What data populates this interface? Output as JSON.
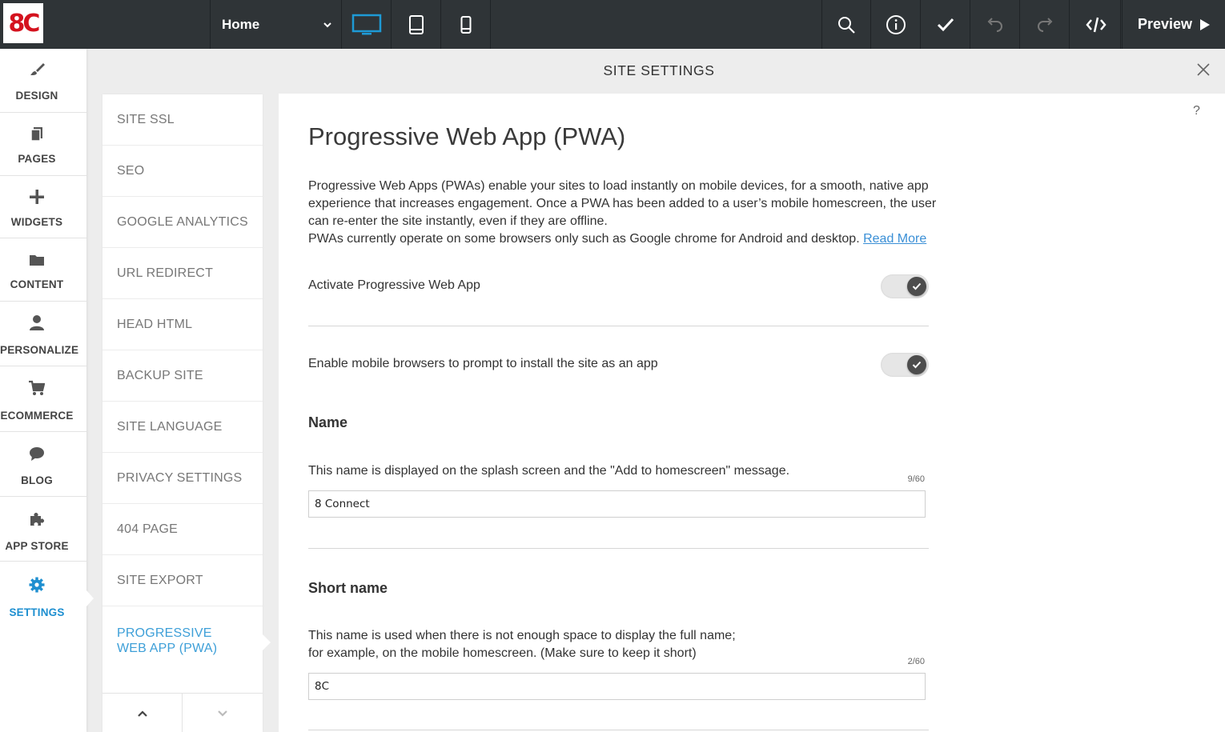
{
  "topbar": {
    "logo_text": "8C",
    "page_select": "Home",
    "devices": [
      "desktop-icon",
      "tablet-icon",
      "mobile-icon"
    ],
    "tools": [
      "search-icon",
      "info-icon",
      "check-icon",
      "undo-icon",
      "redo-icon",
      "code-icon"
    ],
    "preview_label": "Preview",
    "active_device_color": "#1e9ad6"
  },
  "leftnav": {
    "items": [
      {
        "label": "DESIGN",
        "icon": "brush-icon"
      },
      {
        "label": "PAGES",
        "icon": "pages-icon"
      },
      {
        "label": "WIDGETS",
        "icon": "plus-icon"
      },
      {
        "label": "CONTENT",
        "icon": "folder-icon"
      },
      {
        "label": "PERSONALIZE",
        "icon": "person-icon"
      },
      {
        "label": "ECOMMERCE",
        "icon": "cart-icon"
      },
      {
        "label": "BLOG",
        "icon": "chat-icon"
      },
      {
        "label": "APP STORE",
        "icon": "puzzle-icon"
      },
      {
        "label": "SETTINGS",
        "icon": "gear-icon"
      }
    ],
    "active": "SETTINGS"
  },
  "header": {
    "title": "SITE SETTINGS"
  },
  "submenu": {
    "items": [
      "SITE SSL",
      "SEO",
      "GOOGLE ANALYTICS",
      "URL REDIRECT",
      "HEAD HTML",
      "BACKUP SITE",
      "SITE LANGUAGE",
      "PRIVACY SETTINGS",
      "404 PAGE",
      "SITE EXPORT",
      "PROGRESSIVE WEB APP (PWA)"
    ],
    "active": "PROGRESSIVE WEB APP (PWA)"
  },
  "main": {
    "help": "?",
    "title": "Progressive Web App (PWA)",
    "intro_1": "Progressive Web Apps (PWAs) enable your sites to load instantly on mobile devices, for a smooth, native app experience that increases engagement. Once a PWA has been added to a user’s mobile homescreen, the user can re-enter the site instantly, even if they are offline.",
    "intro_2": "PWAs currently operate on some browsers only such as Google chrome for Android and desktop.",
    "read_more": "Read More",
    "activate_label": "Activate Progressive Web App",
    "activate_on": true,
    "prompt_label": "Enable mobile browsers to prompt to install the site as an app",
    "prompt_on": true,
    "name": {
      "title": "Name",
      "desc": "This name is displayed on the splash screen and the \"Add to homescreen\" message.",
      "counter": "9/60",
      "value": "8 Connect"
    },
    "short_name": {
      "title": "Short name",
      "desc_1": "This name is used when there is not enough space to display the full name;",
      "desc_2": "for example, on the mobile homescreen. (Make sure to keep it short)",
      "counter": "2/60",
      "value": "8C"
    }
  }
}
